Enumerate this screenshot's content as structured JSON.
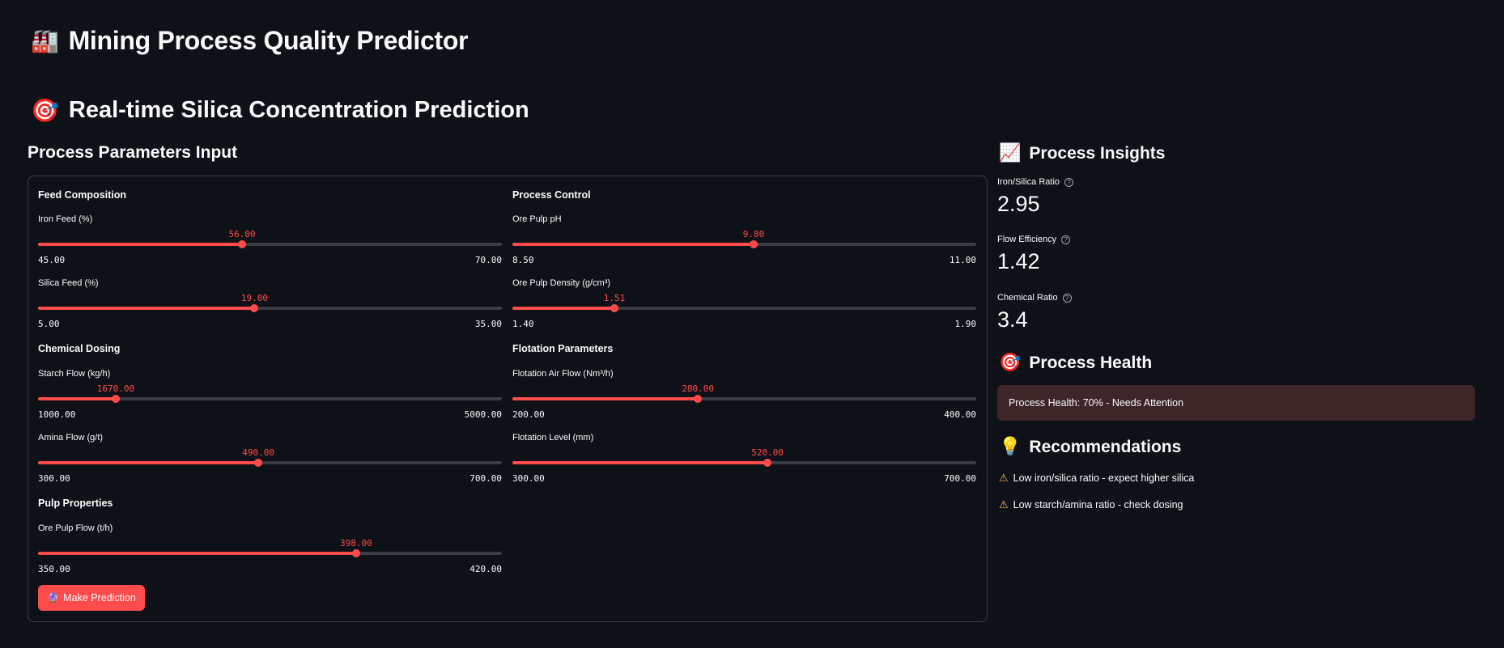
{
  "header": {
    "app_icon": "factory-icon",
    "app_title": "Mining Process Quality Predictor",
    "section_icon": "target-icon",
    "section_title": "Real-time Silica Concentration Prediction"
  },
  "inputs": {
    "heading": "Process Parameters Input",
    "groups": {
      "feed": "Feed Composition",
      "control": "Process Control",
      "dosing": "Chemical Dosing",
      "flotation": "Flotation Parameters",
      "pulp": "Pulp Properties"
    },
    "sliders": {
      "iron_feed": {
        "label": "Iron Feed (%)",
        "value": "56.00",
        "min": "45.00",
        "max": "70.00",
        "fraction": 0.44
      },
      "silica_feed": {
        "label": "Silica Feed (%)",
        "value": "19.00",
        "min": "5.00",
        "max": "35.00",
        "fraction": 0.4667
      },
      "ph": {
        "label": "Ore Pulp pH",
        "value": "9.80",
        "min": "8.50",
        "max": "11.00",
        "fraction": 0.52
      },
      "density": {
        "label": "Ore Pulp Density (g/cm³)",
        "value": "1.51",
        "min": "1.40",
        "max": "1.90",
        "fraction": 0.22
      },
      "starch": {
        "label": "Starch Flow (kg/h)",
        "value": "1670.00",
        "min": "1000.00",
        "max": "5000.00",
        "fraction": 0.1675
      },
      "amina": {
        "label": "Amina Flow (g/t)",
        "value": "490.00",
        "min": "300.00",
        "max": "700.00",
        "fraction": 0.475
      },
      "air": {
        "label": "Flotation Air Flow (Nm³/h)",
        "value": "280.00",
        "min": "200.00",
        "max": "400.00",
        "fraction": 0.4
      },
      "level": {
        "label": "Flotation Level (mm)",
        "value": "520.00",
        "min": "300.00",
        "max": "700.00",
        "fraction": 0.55
      },
      "pulp_flow": {
        "label": "Ore Pulp Flow (t/h)",
        "value": "398.00",
        "min": "350.00",
        "max": "420.00",
        "fraction": 0.6857
      }
    },
    "button_icon": "crystal-ball-icon",
    "button_label": "Make Prediction"
  },
  "insights": {
    "icon": "chart-increasing-icon",
    "heading": "Process Insights",
    "metrics": [
      {
        "label": "Iron/Silica Ratio",
        "value": "2.95"
      },
      {
        "label": "Flow Efficiency",
        "value": "1.42"
      },
      {
        "label": "Chemical Ratio",
        "value": "3.4"
      }
    ]
  },
  "health": {
    "icon": "target-icon",
    "heading": "Process Health",
    "status": "Process Health: 70% - Needs Attention"
  },
  "recommendations": {
    "icon": "light-bulb-icon",
    "heading": "Recommendations",
    "items": [
      "Low iron/silica ratio - expect higher silica",
      "Low starch/amina ratio - check dosing"
    ]
  },
  "colors": {
    "background": "#0e1117",
    "accent": "#ff4b4b",
    "warning": "#ffbd45",
    "health_bg": "#3e2528"
  }
}
